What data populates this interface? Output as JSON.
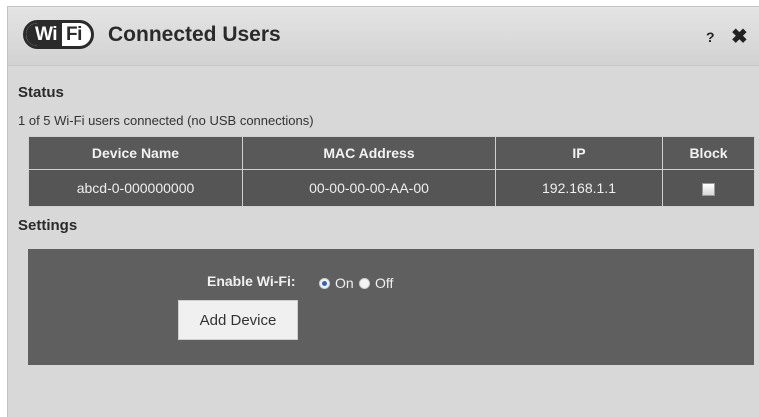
{
  "header": {
    "logo_wi": "Wi",
    "logo_fi": "Fi",
    "title": "Connected Users",
    "help_label": "?",
    "close_label": "✖"
  },
  "status": {
    "heading": "Status",
    "summary": "1 of 5 Wi-Fi users connected (no USB connections)"
  },
  "table": {
    "columns": [
      "Device Name",
      "MAC Address",
      "IP",
      "Block"
    ],
    "rows": [
      {
        "device_name": "abcd-0-000000000",
        "mac": "00-00-00-00-AA-00",
        "ip": "192.168.1.1",
        "block": false
      }
    ]
  },
  "settings": {
    "heading": "Settings",
    "enable_wifi_label": "Enable Wi-Fi:",
    "option_on": "On",
    "option_off": "Off",
    "selected": "On",
    "add_device_label": "Add Device"
  },
  "colors": {
    "dialog_background": "#d8d8d8",
    "panel_background": "#5f5f5f",
    "table_header": "#595959",
    "radio_selected": "#2b63c6"
  }
}
